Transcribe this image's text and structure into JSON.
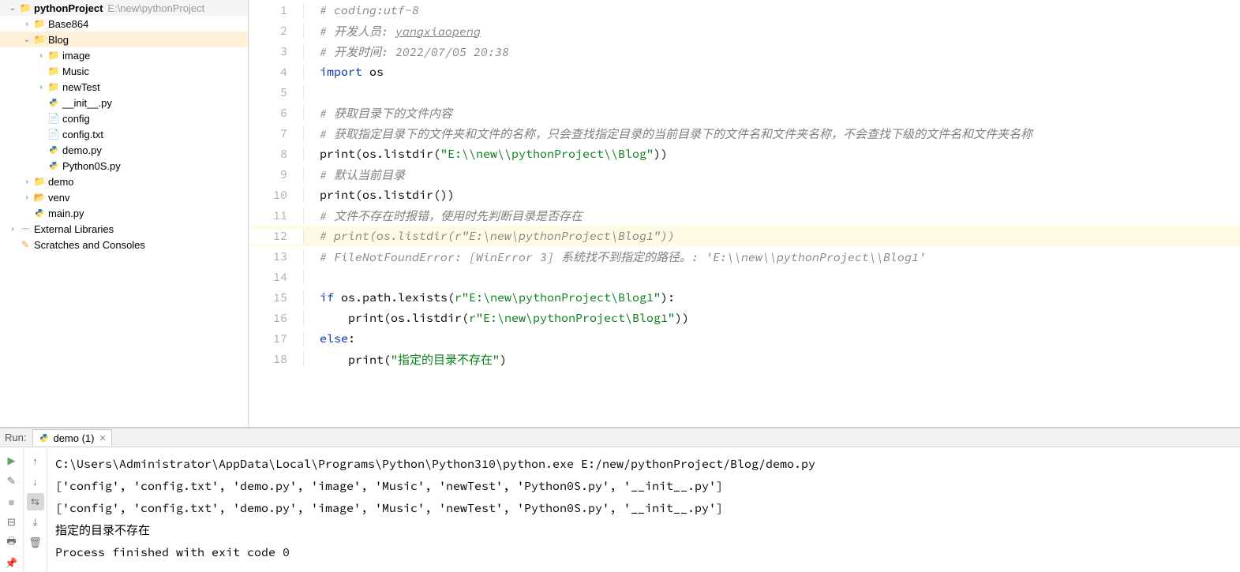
{
  "project": {
    "name": "pythonProject",
    "path": "E:\\new\\pythonProject",
    "tree": [
      {
        "indent": 0,
        "arrow": "down",
        "icon": "folder",
        "label": "pythonProject",
        "bold": true,
        "path": "E:\\new\\pythonProject",
        "selected": false
      },
      {
        "indent": 1,
        "arrow": "right",
        "icon": "folder",
        "label": "Base864",
        "selected": false
      },
      {
        "indent": 1,
        "arrow": "down",
        "icon": "folder",
        "label": "Blog",
        "selected": true
      },
      {
        "indent": 2,
        "arrow": "right",
        "icon": "folder",
        "label": "image",
        "selected": false
      },
      {
        "indent": 2,
        "arrow": "",
        "icon": "folder",
        "label": "Music",
        "selected": false
      },
      {
        "indent": 2,
        "arrow": "right",
        "icon": "folder",
        "label": "newTest",
        "selected": false
      },
      {
        "indent": 2,
        "arrow": "",
        "icon": "py",
        "label": "__init__.py",
        "selected": false
      },
      {
        "indent": 2,
        "arrow": "",
        "icon": "file",
        "label": "config",
        "selected": false
      },
      {
        "indent": 2,
        "arrow": "",
        "icon": "file",
        "label": "config.txt",
        "selected": false
      },
      {
        "indent": 2,
        "arrow": "",
        "icon": "py",
        "label": "demo.py",
        "selected": false
      },
      {
        "indent": 2,
        "arrow": "",
        "icon": "py",
        "label": "Python0S.py",
        "selected": false
      },
      {
        "indent": 1,
        "arrow": "right",
        "icon": "folder",
        "label": "demo",
        "selected": false
      },
      {
        "indent": 1,
        "arrow": "right",
        "icon": "folder-open",
        "label": "venv",
        "selected": false
      },
      {
        "indent": 1,
        "arrow": "",
        "icon": "py",
        "label": "main.py",
        "selected": false
      },
      {
        "indent": 0,
        "arrow": "right",
        "icon": "lib",
        "label": "External Libraries",
        "selected": false
      },
      {
        "indent": 0,
        "arrow": "",
        "icon": "scratch",
        "label": "Scratches and Consoles",
        "selected": false
      }
    ]
  },
  "editor": {
    "current_line": 12,
    "lines": [
      {
        "n": 1,
        "t": "comment",
        "text": "# coding:utf-8"
      },
      {
        "n": 2,
        "t": "comment",
        "parts": [
          {
            "c": "comment",
            "v": "# 开发人员: "
          },
          {
            "c": "comment underline",
            "v": "yangxiaopeng"
          }
        ]
      },
      {
        "n": 3,
        "t": "comment",
        "text": "# 开发时间: 2022/07/05 20:38"
      },
      {
        "n": 4,
        "parts": [
          {
            "c": "keyword",
            "v": "import"
          },
          {
            "c": "ident",
            "v": " os"
          }
        ]
      },
      {
        "n": 5,
        "text": ""
      },
      {
        "n": 6,
        "t": "comment",
        "text": "# 获取目录下的文件内容"
      },
      {
        "n": 7,
        "t": "comment",
        "text": "# 获取指定目录下的文件夹和文件的名称，只会查找指定目录的当前目录下的文件名和文件夹名称，不会查找下级的文件名和文件夹名称"
      },
      {
        "n": 8,
        "parts": [
          {
            "c": "func",
            "v": "print"
          },
          {
            "c": "ident",
            "v": "(os.listdir("
          },
          {
            "c": "string",
            "v": "\"E:\\\\new\\\\pythonProject\\\\Blog\""
          },
          {
            "c": "ident",
            "v": "))"
          }
        ]
      },
      {
        "n": 9,
        "t": "comment",
        "text": "# 默认当前目录"
      },
      {
        "n": 10,
        "parts": [
          {
            "c": "func",
            "v": "print"
          },
          {
            "c": "ident",
            "v": "(os.listdir())"
          }
        ]
      },
      {
        "n": 11,
        "t": "comment",
        "text": "# 文件不存在时报错，使用时先判断目录是否存在"
      },
      {
        "n": 12,
        "t": "comment",
        "text": "# print(os.listdir(r\"E:\\new\\pythonProject\\Blog1\"))",
        "hl": true
      },
      {
        "n": 13,
        "t": "comment",
        "text": "# FileNotFoundError: [WinError 3] 系统找不到指定的路径。: 'E:\\\\new\\\\pythonProject\\\\Blog1'"
      },
      {
        "n": 14,
        "text": ""
      },
      {
        "n": 15,
        "parts": [
          {
            "c": "keyword",
            "v": "if"
          },
          {
            "c": "ident",
            "v": " os.path.lexists("
          },
          {
            "c": "string",
            "v": "r\"E:\\new\\pythonProject\\Blog1\""
          },
          {
            "c": "ident",
            "v": "):"
          }
        ]
      },
      {
        "n": 16,
        "parts": [
          {
            "c": "ident",
            "v": "    "
          },
          {
            "c": "func",
            "v": "print"
          },
          {
            "c": "ident",
            "v": "(os.listdir("
          },
          {
            "c": "string",
            "v": "r\"E:\\new\\pythonProject\\Blog1\""
          },
          {
            "c": "ident",
            "v": "))"
          }
        ]
      },
      {
        "n": 17,
        "parts": [
          {
            "c": "keyword",
            "v": "else"
          },
          {
            "c": "ident",
            "v": ":"
          }
        ]
      },
      {
        "n": 18,
        "parts": [
          {
            "c": "ident",
            "v": "    "
          },
          {
            "c": "func",
            "v": "print"
          },
          {
            "c": "ident",
            "v": "("
          },
          {
            "c": "string",
            "v": "\"指定的目录不存在\""
          },
          {
            "c": "ident",
            "v": ")"
          }
        ]
      }
    ]
  },
  "run": {
    "label": "Run:",
    "tab_name": "demo (1)",
    "output": [
      "C:\\Users\\Administrator\\AppData\\Local\\Programs\\Python\\Python310\\python.exe E:/new/pythonProject/Blog/demo.py",
      "['config', 'config.txt', 'demo.py', 'image', 'Music', 'newTest', 'Python0S.py', '__init__.py']",
      "['config', 'config.txt', 'demo.py', 'image', 'Music', 'newTest', 'Python0S.py', '__init__.py']",
      "指定的目录不存在",
      "",
      "Process finished with exit code 0"
    ]
  }
}
